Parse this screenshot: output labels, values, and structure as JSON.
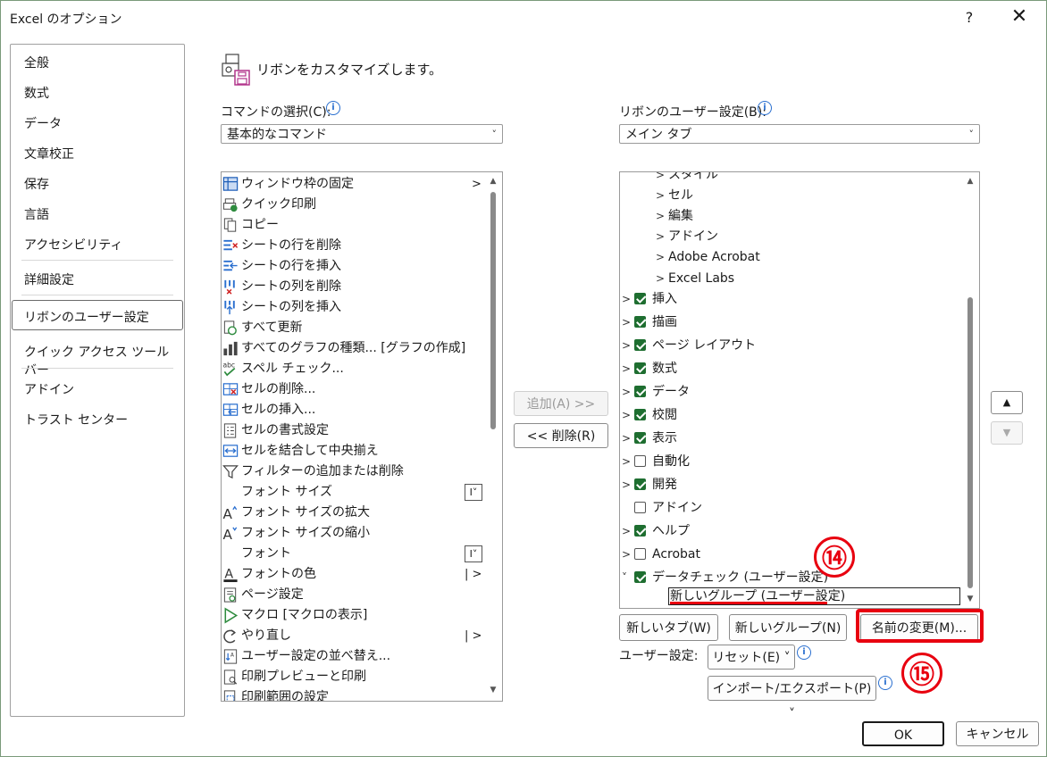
{
  "window": {
    "title": "Excel のオプション",
    "help": "?",
    "close": "✕"
  },
  "nav": {
    "items": [
      "全般",
      "数式",
      "データ",
      "文章校正",
      "保存",
      "言語",
      "アクセシビリティ",
      "詳細設定",
      "リボンのユーザー設定",
      "クイック アクセス ツール バー",
      "アドイン",
      "トラスト センター"
    ],
    "selected": "リボンのユーザー設定"
  },
  "header": {
    "text": "リボンをカスタマイズします。"
  },
  "left": {
    "label": "コマンドの選択(C):",
    "combo_value": "基本的なコマンド",
    "commands": [
      {
        "label": "ウィンドウ枠の固定",
        "icon": "freeze-panes-icon",
        "suffix": "arrow"
      },
      {
        "label": "クイック印刷",
        "icon": "quick-print-icon"
      },
      {
        "label": "コピー",
        "icon": "copy-icon"
      },
      {
        "label": "シートの行を削除",
        "icon": "delete-rows-icon"
      },
      {
        "label": "シートの行を挿入",
        "icon": "insert-rows-icon"
      },
      {
        "label": "シートの列を削除",
        "icon": "delete-columns-icon"
      },
      {
        "label": "シートの列を挿入",
        "icon": "insert-columns-icon"
      },
      {
        "label": "すべて更新",
        "icon": "refresh-all-icon"
      },
      {
        "label": "すべてのグラフの種類... [グラフの作成]",
        "icon": "chart-icon"
      },
      {
        "label": "スペル チェック...",
        "icon": "spell-check-icon"
      },
      {
        "label": "セルの削除...",
        "icon": "delete-cells-icon"
      },
      {
        "label": "セルの挿入...",
        "icon": "insert-cells-icon"
      },
      {
        "label": "セルの書式設定",
        "icon": "format-cells-icon"
      },
      {
        "label": "セルを結合して中央揃え",
        "icon": "merge-center-icon"
      },
      {
        "label": "フィルターの追加または削除",
        "icon": "filter-icon"
      },
      {
        "label": "フォント サイズ",
        "icon": "",
        "suffix": "dropdown"
      },
      {
        "label": "フォント サイズの拡大",
        "icon": "font-grow-icon"
      },
      {
        "label": "フォント サイズの縮小",
        "icon": "font-shrink-icon"
      },
      {
        "label": "フォント",
        "icon": "",
        "suffix": "dropdown"
      },
      {
        "label": "フォントの色",
        "icon": "font-color-icon",
        "suffix": "split"
      },
      {
        "label": "ページ設定",
        "icon": "page-setup-icon"
      },
      {
        "label": "マクロ [マクロの表示]",
        "icon": "macro-icon"
      },
      {
        "label": "やり直し",
        "icon": "redo-icon",
        "suffix": "split"
      },
      {
        "label": "ユーザー設定の並べ替え...",
        "icon": "sort-icon"
      },
      {
        "label": "印刷プレビューと印刷",
        "icon": "print-preview-icon"
      },
      {
        "label": "印刷範囲の設定",
        "icon": "print-area-icon"
      }
    ]
  },
  "middle": {
    "add": "追加(A) >>",
    "remove": "<< 削除(R)"
  },
  "right": {
    "label": "リボンのユーザー設定(B):",
    "combo_value": "メイン タブ",
    "tree": [
      {
        "label": "スタイル",
        "level": 2,
        "checkbox": null
      },
      {
        "label": "セル",
        "level": 2,
        "checkbox": null
      },
      {
        "label": "編集",
        "level": 2,
        "checkbox": null
      },
      {
        "label": "アドイン",
        "level": 2,
        "checkbox": null
      },
      {
        "label": "Adobe Acrobat",
        "level": 2,
        "checkbox": null
      },
      {
        "label": "Excel Labs",
        "level": 2,
        "checkbox": null
      },
      {
        "label": "挿入",
        "level": 1,
        "checkbox": true
      },
      {
        "label": "描画",
        "level": 1,
        "checkbox": true
      },
      {
        "label": "ページ レイアウト",
        "level": 1,
        "checkbox": true
      },
      {
        "label": "数式",
        "level": 1,
        "checkbox": true
      },
      {
        "label": "データ",
        "level": 1,
        "checkbox": true
      },
      {
        "label": "校閲",
        "level": 1,
        "checkbox": true
      },
      {
        "label": "表示",
        "level": 1,
        "checkbox": true
      },
      {
        "label": "自動化",
        "level": 1,
        "checkbox": false
      },
      {
        "label": "開発",
        "level": 1,
        "checkbox": true
      },
      {
        "label": "アドイン",
        "level": 1,
        "checkbox": false,
        "noexpand": true
      },
      {
        "label": "ヘルプ",
        "level": 1,
        "checkbox": true
      },
      {
        "label": "Acrobat",
        "level": 1,
        "checkbox": false
      },
      {
        "label": "データチェック (ユーザー設定)",
        "level": 1,
        "checkbox": true,
        "expanded": true
      }
    ],
    "editing_item": "新しいグループ (ユーザー設定)",
    "new_tab": "新しいタブ(W)",
    "new_group": "新しいグループ(N)",
    "rename": "名前の変更(M)...",
    "custom_label": "ユーザー設定:",
    "reset": "リセット(E) ˅",
    "import_export": "インポート/エクスポート(P) ˅"
  },
  "annotations": {
    "badge14": "⑭",
    "badge15": "⑮",
    "accent": "#e8000f"
  },
  "footer": {
    "ok": "OK",
    "cancel": "キャンセル"
  }
}
